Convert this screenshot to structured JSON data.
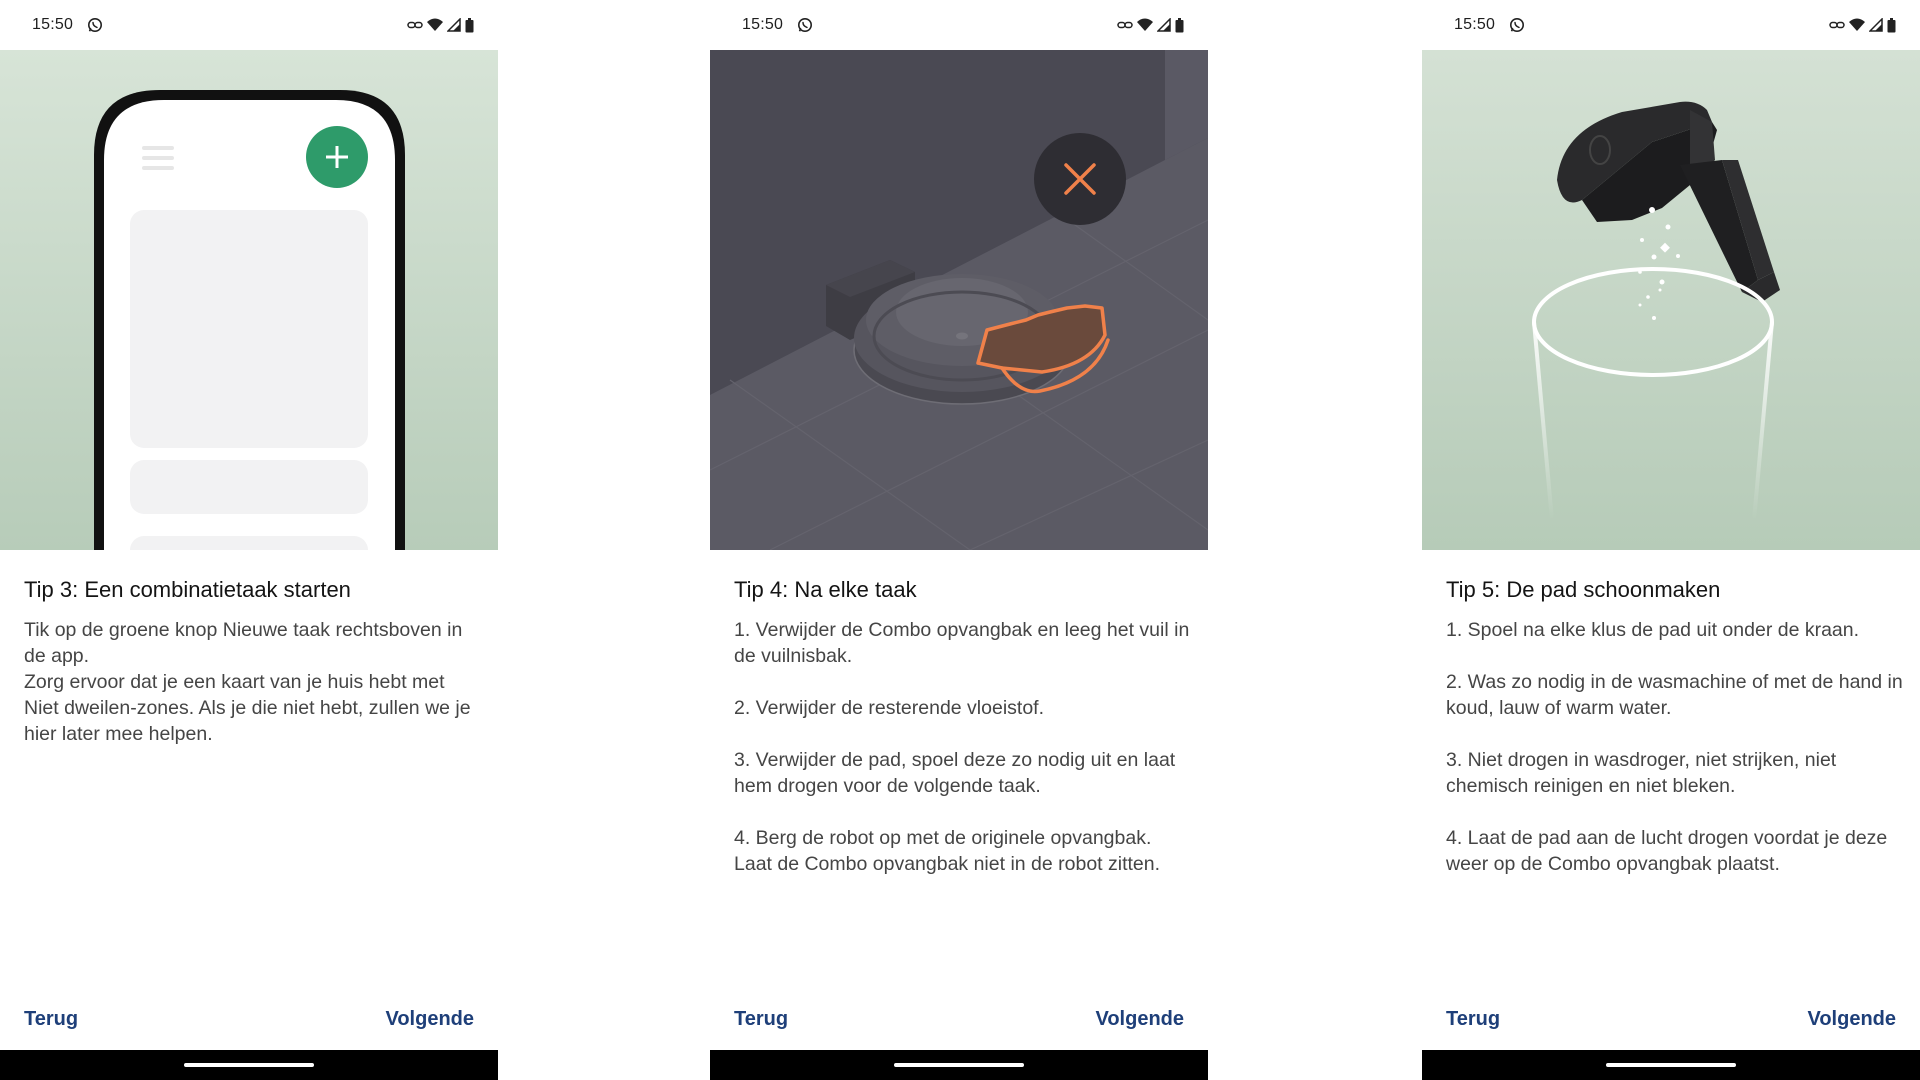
{
  "colors": {
    "accent_green": "#2e9b6a",
    "nav_link": "#1e3f79",
    "highlight_orange": "#f0814a",
    "dark_hero": "#4d4c56",
    "light_hero": "#cfdccf"
  },
  "status_bar": {
    "time": "15:50",
    "icons": [
      "whatsapp-icon",
      "link-icon",
      "wifi-icon",
      "signal-icon",
      "battery-icon"
    ]
  },
  "screens": [
    {
      "illustration": "phone-app-new-task-illustration",
      "title": "Tip 3: Een combinatietaak starten",
      "paragraphs": [
        "Tik op de groene knop Nieuwe taak rechtsboven in de app.\nZorg ervoor dat je een kaart van je huis hebt met Niet dweilen-zones. Als je die niet hebt, zullen we je hier later mee helpen."
      ],
      "back_label": "Terug",
      "next_label": "Volgende"
    },
    {
      "illustration": "robot-remove-bin-illustration",
      "title": "Tip 4: Na elke taak",
      "paragraphs": [
        "1. Verwijder de Combo opvangbak en leeg het vuil in de vuilnisbak.",
        "2. Verwijder de resterende vloeistof.",
        "3. Verwijder de pad, spoel deze zo nodig uit en laat hem drogen voor de volgende taak.",
        "4. Berg de robot op met de originele opvangbak. Laat de Combo opvangbak niet in de robot zitten."
      ],
      "back_label": "Terug",
      "next_label": "Volgende"
    },
    {
      "illustration": "empty-bin-into-trash-illustration",
      "title": "Tip 5: De pad schoonmaken",
      "paragraphs": [
        "1. Spoel na elke klus de pad uit onder de kraan.",
        "2. Was zo nodig in de wasmachine of met de hand in koud, lauw of warm water.",
        "3. Niet drogen in wasdroger, niet strijken, niet chemisch reinigen en niet bleken.",
        "4. Laat de pad aan de lucht drogen voordat je deze weer op de Combo opvangbak plaatst."
      ],
      "back_label": "Terug",
      "next_label": "Volgende"
    }
  ]
}
